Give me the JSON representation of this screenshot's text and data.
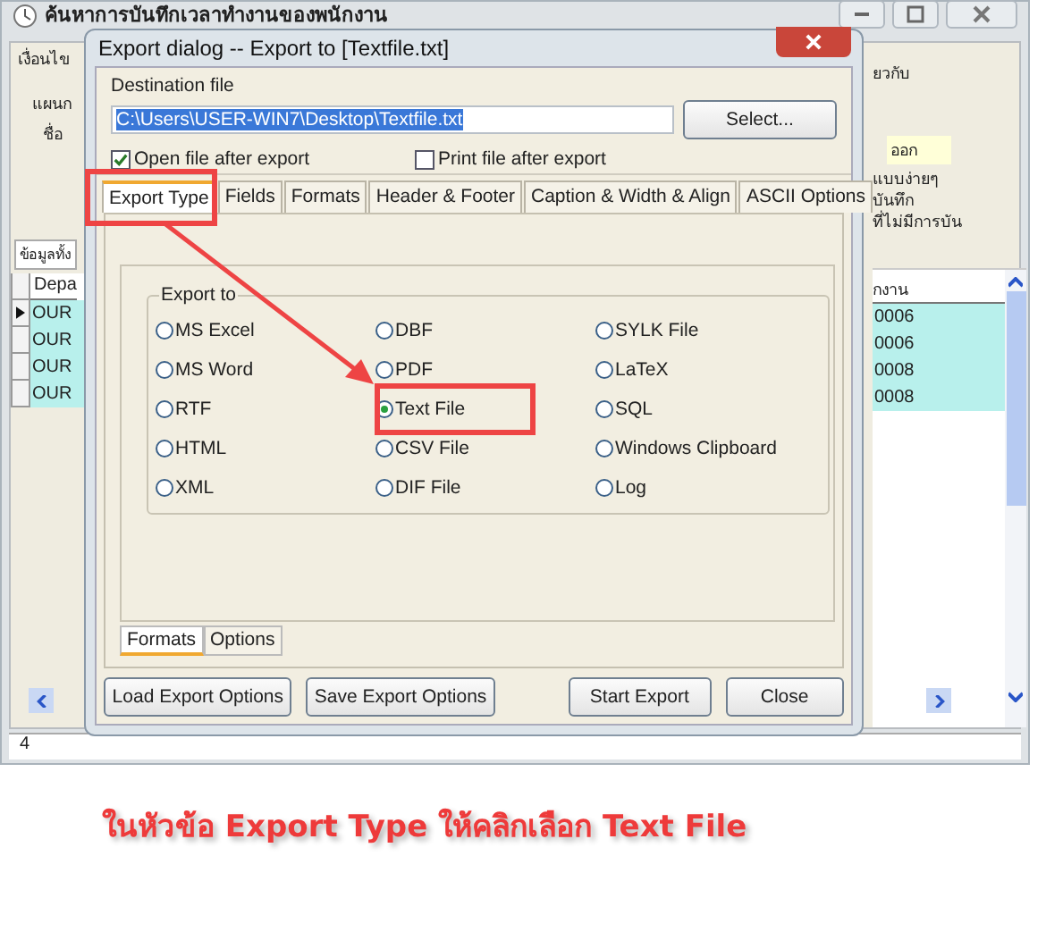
{
  "background_window": {
    "title": "ค้นหาการบันทึกเวลาทำงานของพนักงาน",
    "left_labels": [
      "เงื่อนไข",
      "แผนก",
      "ชื่อ"
    ],
    "tab": "ข้อมูลทั้ง",
    "left_grid": {
      "header": "Depa",
      "rows": [
        {
          "text": "OUR",
          "selected": true
        },
        {
          "text": "OUR",
          "selected": false
        },
        {
          "text": "OUR",
          "selected": false
        },
        {
          "text": "OUR",
          "selected": false
        }
      ]
    },
    "right_top": "ยวกับ",
    "right_field": "ออก",
    "right_labels": [
      "แบบง่ายๆ",
      "บันทึก",
      "ที่ไม่มีการบัน"
    ],
    "right_grid": {
      "header": "กงาน",
      "rows": [
        "0006",
        "0006",
        "0008",
        "0008"
      ]
    },
    "status": "4"
  },
  "dialog": {
    "title": "Export dialog -- Export to [Textfile.txt]",
    "destination_label": "Destination file",
    "destination_value": "C:\\Users\\USER-WIN7\\Desktop\\Textfile.txt",
    "select_button": "Select...",
    "checkboxes": [
      {
        "label": "Open file after export",
        "checked": true
      },
      {
        "label": "Print file after export",
        "checked": false
      }
    ],
    "tabs": [
      {
        "label": "Export Type",
        "selected": true
      },
      {
        "label": "Fields",
        "selected": false
      },
      {
        "label": "Formats",
        "selected": false
      },
      {
        "label": "Header & Footer",
        "selected": false
      },
      {
        "label": "Caption & Width & Align",
        "selected": false
      },
      {
        "label": "ASCII Options",
        "selected": false
      }
    ],
    "group_title": "Export to",
    "options": [
      {
        "label": "MS Excel",
        "selected": false
      },
      {
        "label": "DBF",
        "selected": false
      },
      {
        "label": "SYLK File",
        "selected": false
      },
      {
        "label": "MS Word",
        "selected": false
      },
      {
        "label": "PDF",
        "selected": false
      },
      {
        "label": "LaTeX",
        "selected": false
      },
      {
        "label": "RTF",
        "selected": false
      },
      {
        "label": "Text File",
        "selected": true
      },
      {
        "label": "SQL",
        "selected": false
      },
      {
        "label": "HTML",
        "selected": false
      },
      {
        "label": "CSV File",
        "selected": false
      },
      {
        "label": "Windows Clipboard",
        "selected": false
      },
      {
        "label": "XML",
        "selected": false
      },
      {
        "label": "DIF File",
        "selected": false
      },
      {
        "label": "Log",
        "selected": false
      }
    ],
    "subtabs": [
      {
        "label": "Formats",
        "selected": true
      },
      {
        "label": "Options",
        "selected": false
      }
    ],
    "buttons": [
      "Load Export Options",
      "Save Export Options",
      "Start Export",
      "Close"
    ]
  },
  "caption": "ในหัวข้อ Export Type ให้คลิกเลือก Text File"
}
